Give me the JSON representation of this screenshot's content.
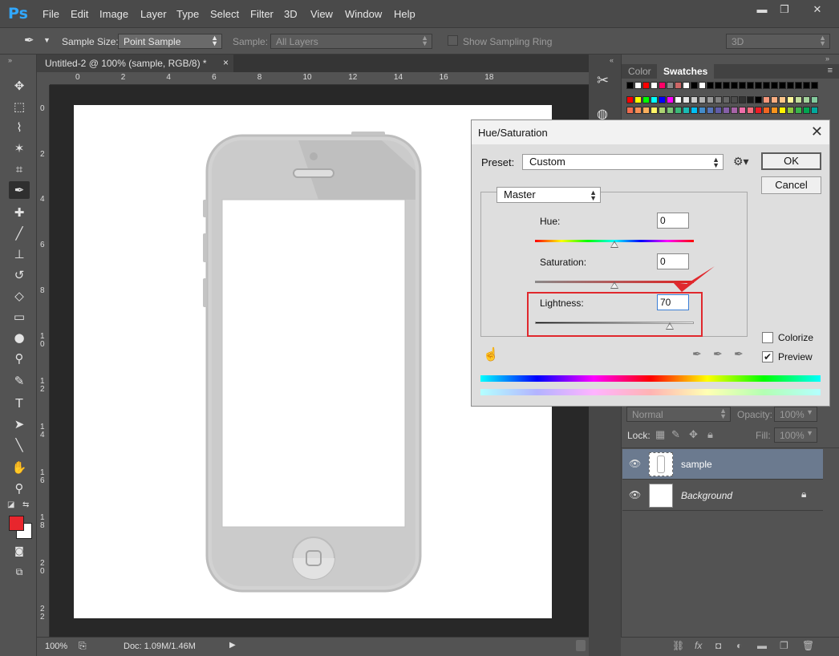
{
  "app": {
    "logo": "Ps"
  },
  "menu": [
    "File",
    "Edit",
    "Image",
    "Layer",
    "Type",
    "Select",
    "Filter",
    "3D",
    "View",
    "Window",
    "Help"
  ],
  "window_controls": {
    "minimize": "▬",
    "restore": "❐",
    "close": "✕"
  },
  "options": {
    "sample_size_label": "Sample Size:",
    "sample_size_value": "Point Sample",
    "sample_label": "Sample:",
    "sample_value": "All Layers",
    "show_ring_label": "Show Sampling Ring",
    "workspace": "3D"
  },
  "document": {
    "tab_title": "Untitled-2 @ 100% (sample, RGB/8) *",
    "ruler_h": [
      "0",
      "2",
      "4",
      "6",
      "8",
      "10",
      "12",
      "14",
      "16",
      "18"
    ],
    "ruler_v": [
      "0",
      "2",
      "4",
      "6",
      "8",
      "1\n0",
      "1\n2",
      "1\n4",
      "1\n6",
      "1\n8",
      "2\n0",
      "2\n2"
    ],
    "zoom": "100%",
    "doc_info": "Doc: 1.09M/1.46M"
  },
  "colors": {
    "foreground": "#e8262d",
    "background": "#ffffff",
    "accent_red": "#e0282d",
    "phone_gray": "#c9c9c9"
  },
  "panels": {
    "tabs": [
      "Color",
      "Swatches"
    ],
    "active_tab": "Swatches",
    "blend_mode": "Normal",
    "opacity_label": "Opacity:",
    "opacity_value": "100%",
    "lock_label": "Lock:",
    "fill_label": "Fill:",
    "fill_value": "100%",
    "layers": [
      {
        "name": "sample",
        "selected": true,
        "italic": false
      },
      {
        "name": "Background",
        "selected": false,
        "italic": true
      }
    ]
  },
  "dialog": {
    "title": "Hue/Saturation",
    "preset_label": "Preset:",
    "preset_value": "Custom",
    "channel": "Master",
    "hue_label": "Hue:",
    "hue_value": "0",
    "saturation_label": "Saturation:",
    "saturation_value": "0",
    "lightness_label": "Lightness:",
    "lightness_value": "70",
    "ok_label": "OK",
    "cancel_label": "Cancel",
    "colorize_label": "Colorize",
    "preview_label": "Preview",
    "colorize_checked": false,
    "preview_checked": true,
    "hue_slider_fraction": 0.5,
    "saturation_slider_fraction": 0.5,
    "lightness_slider_fraction": 0.85
  }
}
